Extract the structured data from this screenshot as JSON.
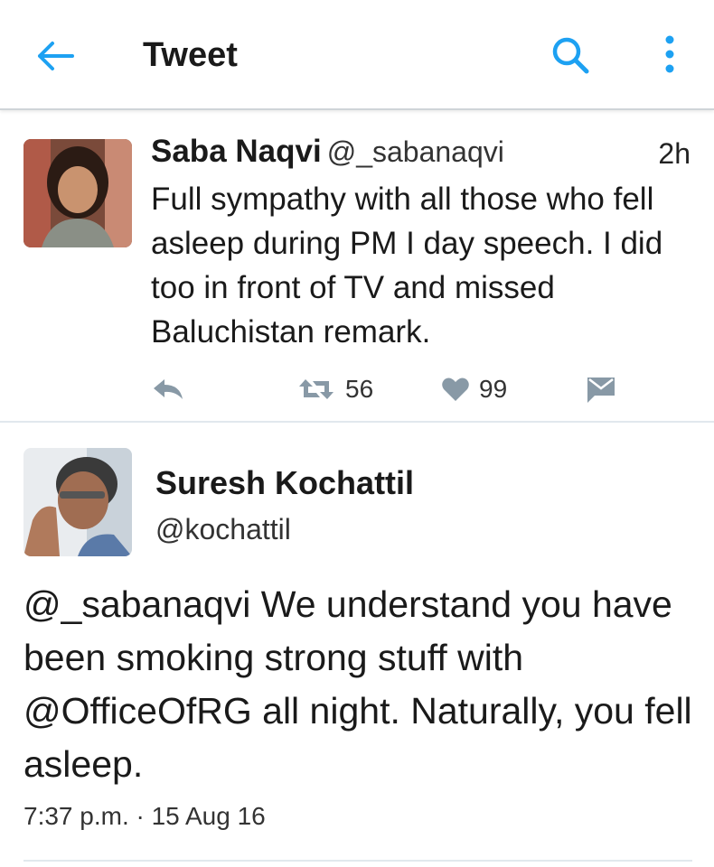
{
  "header": {
    "title": "Tweet",
    "back_icon": "arrow-left-icon",
    "search_icon": "search-icon",
    "more_icon": "more-vertical-icon",
    "accent_color": "#1da1f2"
  },
  "tweet1": {
    "name": "Saba Naqvi",
    "handle": "@_sabanaqvi",
    "time": "2h",
    "text": "Full sympathy with all those who fell asleep during PM I day speech. I did too in front of TV and missed Baluchistan remark.",
    "retweets": "56",
    "likes": "99",
    "icons": [
      "reply-icon",
      "retweet-icon",
      "heart-icon",
      "dm-icon"
    ]
  },
  "tweet2": {
    "name": "Suresh Kochattil",
    "handle": "@kochattil",
    "mention1": "@_sabanaqvi",
    "text_part1": " We understand you have been smoking strong stuff with ",
    "mention2": "@OfficeOfRG",
    "text_part2": " all night. Naturally, you fell asleep.",
    "timestamp": "7:37 p.m. · 15 Aug 16"
  }
}
